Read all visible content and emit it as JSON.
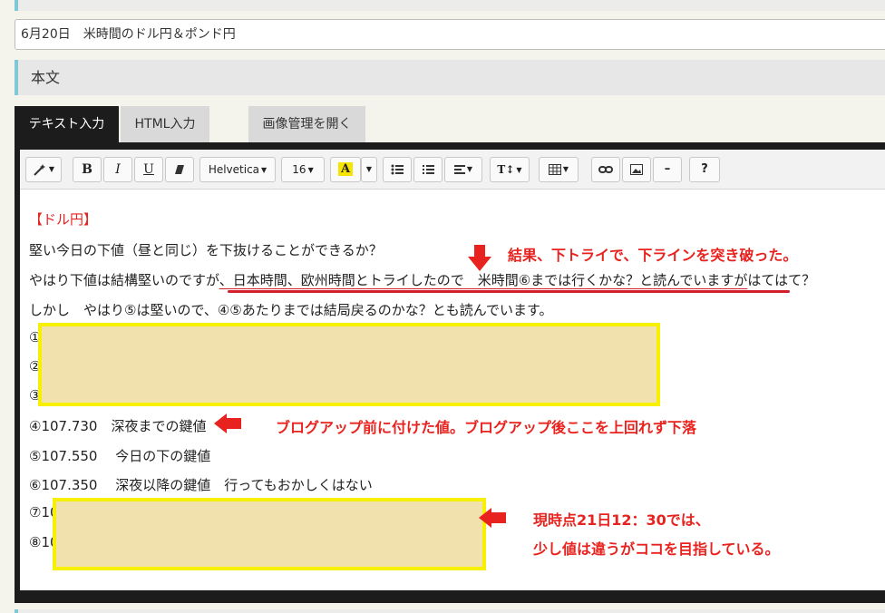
{
  "post": {
    "title_value": "6月20日　米時間のドル円＆ポンド円",
    "section_heading": "本文"
  },
  "tabs": {
    "text_input": "テキスト入力",
    "html_input": "HTML入力",
    "image_manager": "画像管理を開く"
  },
  "toolbar": {
    "magic": "magic-wand-icon",
    "bold": "B",
    "italic": "I",
    "underline": "U",
    "eraser": "eraser-icon",
    "font_family": "Helvetica",
    "font_size": "16",
    "highlight": "A",
    "text_height": "T↕",
    "hr": "–",
    "help": "?",
    "accent_highlight": "#f7e400"
  },
  "content": {
    "heading": "【ドル円】",
    "line1": "堅い今日の下値（昼と同じ）を下抜けることができるか？",
    "line2_prefix": "やはり下値は結構堅いのですが",
    "line2_underlined": "、日本時間、欧州時間とトライしたので　米時間⑥までは行くかな？と読んでいますが",
    "line2_suffix": "はてはて？",
    "line3": "しかし　やはり⑤は堅いので、④⑤あたりまでは結局戻るのかな？とも読んでいます。",
    "item1": "①",
    "item2": "②",
    "item3": "③",
    "item4": "④107.730　深夜までの鍵値",
    "item5": "⑤107.550　 今日の下の鍵値",
    "item6": "⑥107.350　 深夜以降の鍵値　行ってもおかしくはない",
    "item7": "⑦10",
    "item8": "⑧10"
  },
  "annotations": {
    "note1": "結果、下トライで、下ラインを突き破った。",
    "note2": "ブログアップ前に付けた値。ブログアップ後ここを上回れず下落",
    "note3_line1": "現時点21日12：30では、",
    "note3_line2": "少し値は違うがココを目指している。",
    "color": "#e8231f"
  }
}
